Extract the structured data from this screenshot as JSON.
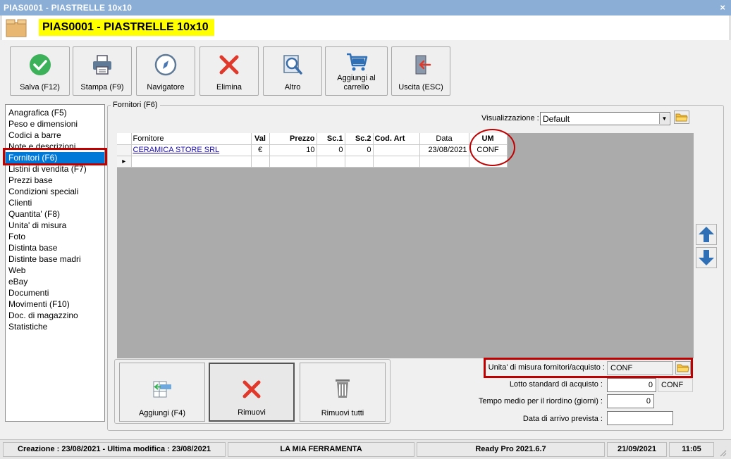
{
  "window": {
    "title": "PIAS0001 - PIASTRELLE 10x10",
    "close_glyph": "×"
  },
  "header": {
    "doc_title": "PIAS0001 - PIASTRELLE 10x10"
  },
  "toolbar": {
    "save": "Salva (F12)",
    "print": "Stampa (F9)",
    "navigator": "Navigatore",
    "delete": "Elimina",
    "other": "Altro",
    "add_to_cart_line1": "Aggiungi al",
    "add_to_cart_line2": "carrello",
    "exit": "Uscita (ESC)"
  },
  "nav": {
    "items": [
      "Anagrafica (F5)",
      "Peso e dimensioni",
      "Codici a barre",
      "Note e descrizioni",
      "Fornitori (F6)",
      "Listini di vendita (F7)",
      "Prezzi base",
      "Condizioni speciali",
      "Clienti",
      "Quantita' (F8)",
      "Unita' di misura",
      "Foto",
      "Distinta base",
      "Distinte base madri",
      "Web",
      "eBay",
      "Documenti",
      "Movimenti (F10)",
      "Doc. di magazzino",
      "Statistiche"
    ],
    "selected": "Fornitori (F6)"
  },
  "panel": {
    "group_title": "Fornitori (F6)",
    "view_label": "Visualizzazione :",
    "view_value": "Default"
  },
  "grid": {
    "columns": [
      "Fornitore",
      "Val",
      "Prezzo",
      "Sc.1",
      "Sc.2",
      "Cod. Art",
      "Data",
      "UM"
    ],
    "rows": [
      {
        "fornitore": "CERAMICA STORE SRL",
        "val": "€",
        "prezzo": "10",
        "sc1": "0",
        "sc2": "0",
        "cod_art": "",
        "data": "23/08/2021",
        "um": "CONF"
      }
    ],
    "new_row_glyph": "▸"
  },
  "bottom_buttons": {
    "add": "Aggiungi (F4)",
    "remove": "Rimuovi",
    "remove_all": "Rimuovi tutti"
  },
  "form": {
    "um_label": "Unita' di misura fornitori/acquisto :",
    "um_value": "CONF",
    "lot_label": "Lotto standard di acquisto :",
    "lot_value": "0",
    "lot_unit": "CONF",
    "reorder_label": "Tempo medio per il riordino (giorni) :",
    "reorder_value": "0",
    "arrival_label": "Data di arrivo prevista :",
    "arrival_value": ""
  },
  "status": {
    "created": "Creazione : 23/08/2021 - Ultima modifica : 23/08/2021",
    "company": "LA MIA FERRAMENTA",
    "app": "Ready Pro 2021.6.7",
    "date": "21/09/2021",
    "time": "11:05"
  },
  "colors": {
    "accent": "#0078d7",
    "highlight": "#c00000",
    "title_yellow": "#ffff00",
    "titlebar": "#8aaed6"
  }
}
